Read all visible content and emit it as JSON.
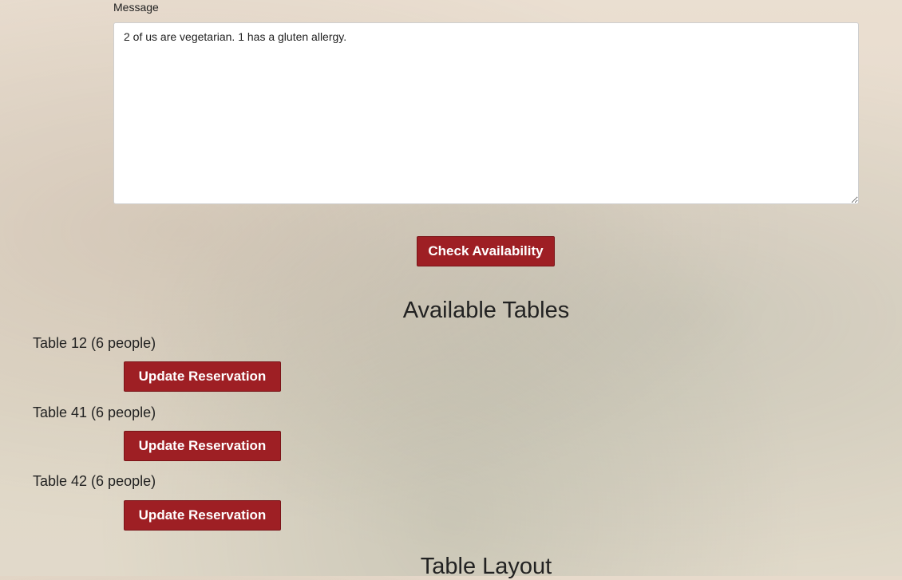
{
  "message": {
    "label": "Message",
    "value": "2 of us are vegetarian. 1 has a gluten allergy."
  },
  "check_button": "Check Availability",
  "available_tables": {
    "title": "Available Tables",
    "tables": [
      {
        "label": "Table 12 (6 people)",
        "button": "Update Reservation"
      },
      {
        "label": "Table 41 (6 people)",
        "button": "Update Reservation"
      },
      {
        "label": "Table 42 (6 people)",
        "button": "Update Reservation"
      }
    ]
  },
  "table_layout": {
    "title": "Table Layout"
  },
  "colors": {
    "button_bg": "#9e1f24"
  }
}
